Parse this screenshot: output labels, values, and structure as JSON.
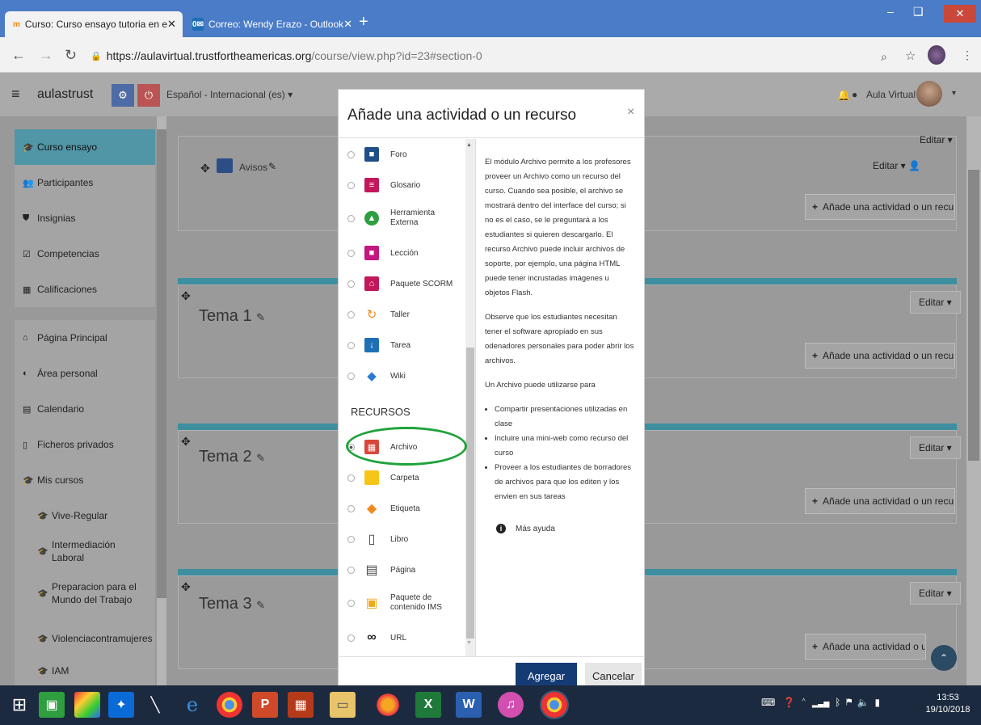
{
  "browser": {
    "tabs": [
      {
        "title": "Curso: Curso ensayo tutoria en e",
        "favicon": "m",
        "active": true
      },
      {
        "title": "Correo: Wendy Erazo - Outlook",
        "favicon": "0✉",
        "active": false
      }
    ],
    "new_tab": "+",
    "url_host": "https://aulavirtual.trustfortheamericas.org",
    "url_path": "/course/view.php?id=23#section-0",
    "window": {
      "minimize": "–",
      "maximize": "❑",
      "close": "✕"
    }
  },
  "navbar": {
    "brand": "aulastrust",
    "language": "Español - Internacional (es) ▾",
    "user": "Aula Virtual",
    "caret": "▾"
  },
  "drawer": {
    "block1": [
      {
        "label": "Curso ensayo",
        "icon": "graduation-cap-icon",
        "glyph": "🎓",
        "active": true
      },
      {
        "label": "Participantes",
        "icon": "users-icon",
        "glyph": "👥"
      },
      {
        "label": "Insignias",
        "icon": "shield-icon",
        "glyph": "⛊"
      },
      {
        "label": "Competencias",
        "icon": "checkbox-icon",
        "glyph": "☑"
      },
      {
        "label": "Calificaciones",
        "icon": "table-icon",
        "glyph": "▦"
      }
    ],
    "block2": [
      {
        "label": "Página Principal",
        "icon": "home-icon",
        "glyph": "⌂"
      },
      {
        "label": "Área personal",
        "icon": "dashboard-icon",
        "glyph": "◐"
      },
      {
        "label": "Calendario",
        "icon": "calendar-icon",
        "glyph": "▤"
      },
      {
        "label": "Ficheros privados",
        "icon": "file-icon",
        "glyph": "▯"
      },
      {
        "label": "Mis cursos",
        "icon": "graduation-cap-icon",
        "glyph": "🎓"
      },
      {
        "label": "Vive-Regular",
        "icon": "graduation-cap-icon",
        "glyph": "🎓",
        "sub": true
      },
      {
        "label": "Intermediación Laboral",
        "icon": "graduation-cap-icon",
        "glyph": "🎓",
        "sub": true
      },
      {
        "label": "Preparacion para el Mundo del Trabajo",
        "icon": "graduation-cap-icon",
        "glyph": "🎓",
        "sub": true
      },
      {
        "label": "Violenciacontramujeres",
        "icon": "graduation-cap-icon",
        "glyph": "🎓",
        "sub": true
      },
      {
        "label": "IAM",
        "icon": "graduation-cap-icon",
        "glyph": "🎓",
        "sub": true
      }
    ]
  },
  "course": {
    "edit_label": "Editar ▾",
    "avisos": "Avisos",
    "add_label": "Añade una actividad o un recurso",
    "add_label_cut": "Añade una actividad o un r",
    "sections": [
      "Tema 1",
      "Tema 2",
      "Tema 3"
    ]
  },
  "modal": {
    "title": "Añade una actividad o un recurso",
    "close": "×",
    "activities": [
      {
        "label": "Foro",
        "color": "#1f4f86",
        "glyph": "■"
      },
      {
        "label": "Glosario",
        "color": "#c2185b",
        "glyph": "≡"
      },
      {
        "label": "Herramienta Externa",
        "color": "#2e9e3f",
        "glyph": "▲"
      },
      {
        "label": "Lección",
        "color": "#c2187f",
        "glyph": "■"
      },
      {
        "label": "Paquete SCORM",
        "color": "#c2185b",
        "glyph": "⌂"
      },
      {
        "label": "Taller",
        "color": "#f08a1c",
        "glyph": "↻"
      },
      {
        "label": "Tarea",
        "color": "#1f6fb5",
        "glyph": "↓"
      },
      {
        "label": "Wiki",
        "color": "#2b7cd0",
        "glyph": "◆"
      }
    ],
    "resources_heading": "RECURSOS",
    "resources": [
      {
        "label": "Archivo",
        "color": "#d8473a",
        "glyph": "▦",
        "checked": true
      },
      {
        "label": "Carpeta",
        "color": "#f5c518",
        "glyph": "▬"
      },
      {
        "label": "Etiqueta",
        "color": "#f08a1c",
        "glyph": "◆"
      },
      {
        "label": "Libro",
        "color": "#444444",
        "glyph": "▯"
      },
      {
        "label": "Página",
        "color": "#444444",
        "glyph": "▤"
      },
      {
        "label": "Paquete de contenido IMS",
        "color": "#f0a91c",
        "glyph": "▣"
      },
      {
        "label": "URL",
        "color": "#222222",
        "glyph": "∞"
      }
    ],
    "description": {
      "p1": "El módulo Archivo permite a los profesores proveer un Archivo como un recurso del curso. Cuando sea posible, el archivo se mostrará dentro del interface del curso; si no es el caso, se le preguntará a los estudiantes si quieren descargarlo. El recurso Archivo puede incluir archivos de soporte, por ejemplo, una página HTML puede tener incrustadas imágenes u objetos Flash.",
      "p2": "Observe que los estudiantes necesitan tener el software apropiado en sus odenadores personales para poder abrir los archivos.",
      "p3": "Un Archivo puede utilizarse para",
      "bullets": [
        "Compartir presentaciones utilizadas en clase",
        "Incluire una mini-web como recurso del curso",
        "Proveer a los estudiantes de borradores de archivos para que los editen y los envien en sus tareas"
      ],
      "help": "Más ayuda"
    },
    "add_button": "Agregar",
    "cancel_button": "Cancelar"
  },
  "taskbar": {
    "time": "13:53",
    "date": "19/10/2018"
  },
  "colors": {
    "tabstrip": "#4a7cc7",
    "active_nav": "#5096a6",
    "section_bar": "#3d8fa0",
    "primary_button": "#143b74",
    "highlight_ellipse": "#1ea23a"
  }
}
